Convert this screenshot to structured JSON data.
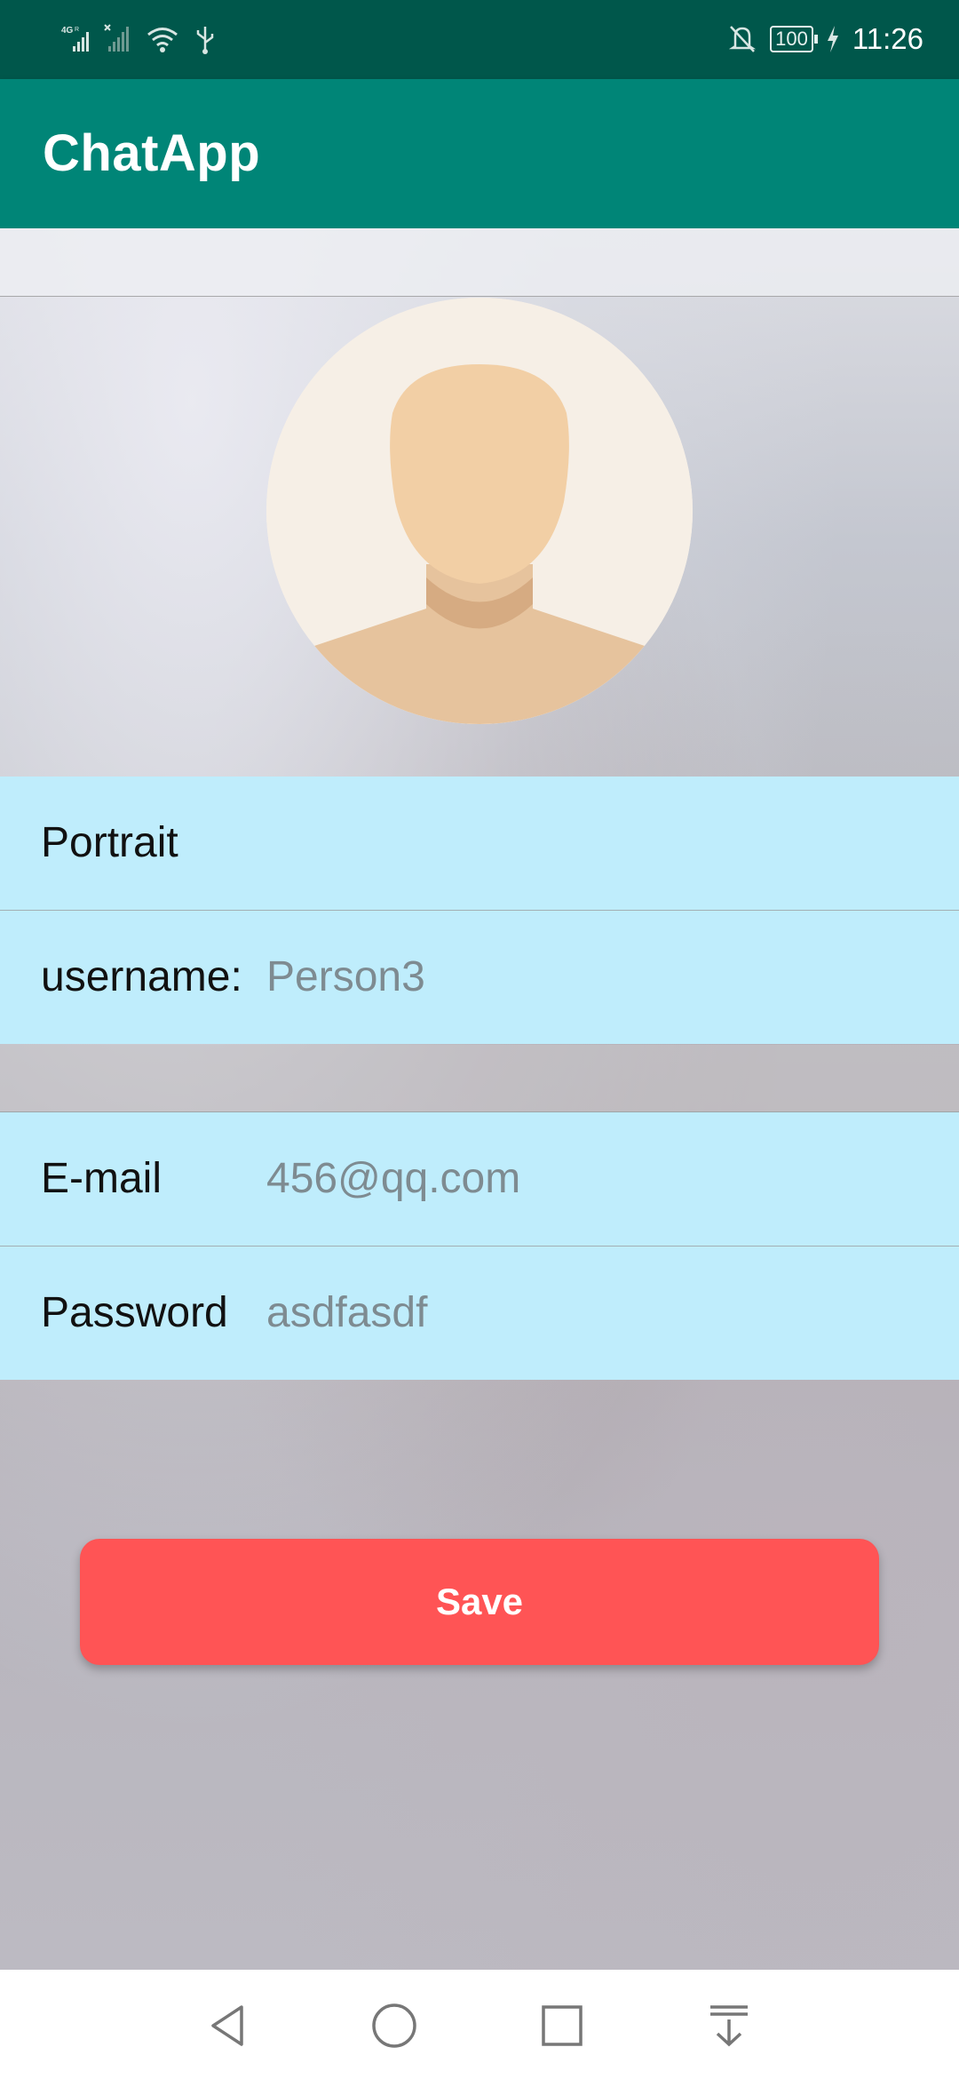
{
  "status_bar": {
    "network_type": "4G",
    "battery": "100",
    "time": "11:26"
  },
  "app_bar": {
    "title": "ChatApp"
  },
  "profile": {
    "portrait_label": "Portrait",
    "username_label": "username:",
    "username_value": "Person3",
    "email_label": "E-mail",
    "email_value": "456@qq.com",
    "password_label": "Password",
    "password_value": "asdfasdf"
  },
  "actions": {
    "save_label": "Save"
  },
  "colors": {
    "status_bar": "#00574b",
    "app_bar": "#008577",
    "row_background": "#bfedfc",
    "save_button": "#ff5455"
  },
  "icons": {
    "status_left": [
      "signal-4g-icon",
      "signal-no-sim-icon",
      "wifi-icon",
      "usb-icon"
    ],
    "status_right": [
      "notifications-off-icon",
      "battery-icon",
      "charging-icon"
    ],
    "navigation": [
      "back-icon",
      "home-icon",
      "recents-icon",
      "notification-pull-icon"
    ]
  }
}
